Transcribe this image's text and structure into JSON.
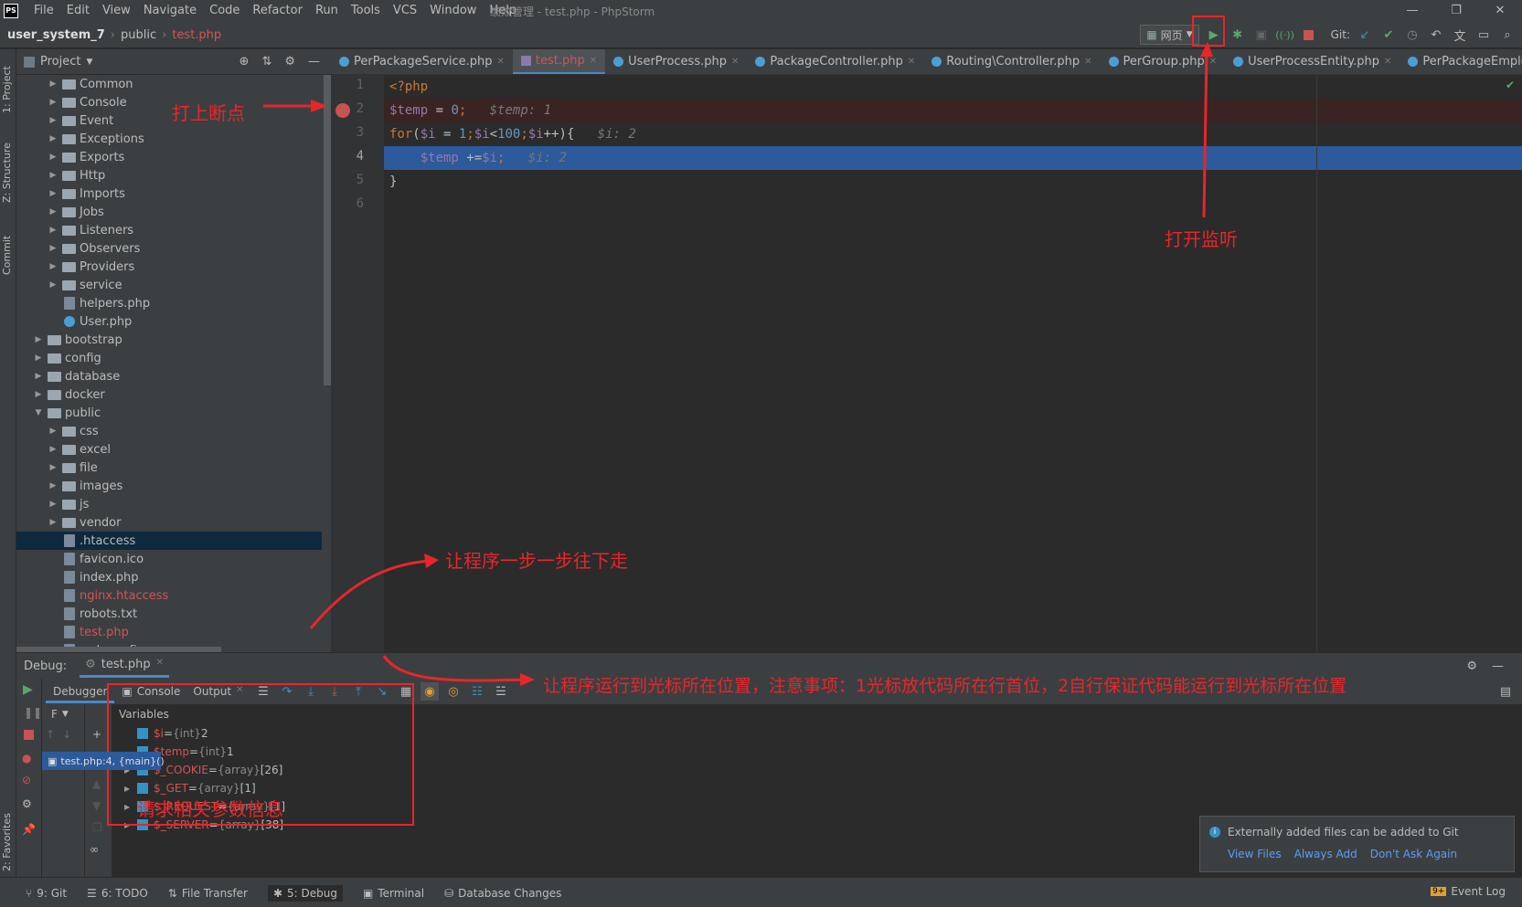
{
  "app": {
    "logo": "PS",
    "title": "绩效管理 - test.php - PhpStorm"
  },
  "menu": [
    "File",
    "Edit",
    "View",
    "Navigate",
    "Code",
    "Refactor",
    "Run",
    "Tools",
    "VCS",
    "Window",
    "Help"
  ],
  "breadcrumb": {
    "project": "user_system_7",
    "folder": "public",
    "file": "test.php"
  },
  "toolbar": {
    "run_config": "网页",
    "git_label": "Git:"
  },
  "project_panel": {
    "title": "Project",
    "items": [
      {
        "label": "Common",
        "type": "folder"
      },
      {
        "label": "Console",
        "type": "folder"
      },
      {
        "label": "Event",
        "type": "folder"
      },
      {
        "label": "Exceptions",
        "type": "folder"
      },
      {
        "label": "Exports",
        "type": "folder"
      },
      {
        "label": "Http",
        "type": "folder"
      },
      {
        "label": "Imports",
        "type": "folder"
      },
      {
        "label": "Jobs",
        "type": "folder"
      },
      {
        "label": "Listeners",
        "type": "folder"
      },
      {
        "label": "Observers",
        "type": "folder"
      },
      {
        "label": "Providers",
        "type": "folder"
      },
      {
        "label": "service",
        "type": "folder"
      },
      {
        "label": "helpers.php",
        "type": "file"
      },
      {
        "label": "User.php",
        "type": "class"
      },
      {
        "label": "bootstrap",
        "type": "folder"
      },
      {
        "label": "config",
        "type": "folder"
      },
      {
        "label": "database",
        "type": "folder"
      },
      {
        "label": "docker",
        "type": "folder"
      },
      {
        "label": "public",
        "type": "folder-open"
      },
      {
        "label": "css",
        "type": "folder"
      },
      {
        "label": "excel",
        "type": "folder"
      },
      {
        "label": "file",
        "type": "folder"
      },
      {
        "label": "images",
        "type": "folder"
      },
      {
        "label": "js",
        "type": "folder"
      },
      {
        "label": "vendor",
        "type": "folder"
      },
      {
        "label": ".htaccess",
        "type": "file"
      },
      {
        "label": "favicon.ico",
        "type": "file"
      },
      {
        "label": "index.php",
        "type": "file"
      },
      {
        "label": "nginx.htaccess",
        "type": "file-red"
      },
      {
        "label": "robots.txt",
        "type": "file"
      },
      {
        "label": "test.php",
        "type": "file-red"
      },
      {
        "label": "web.config",
        "type": "file"
      }
    ]
  },
  "tabs": [
    "PerPackageService.php",
    "test.php",
    "UserProcess.php",
    "PackageController.php",
    "Routing\\Controller.php",
    "PerGroup.php",
    "UserProcessEntity.php",
    "PerPackageEmployee."
  ],
  "code": {
    "lines": [
      "1",
      "2",
      "3",
      "4",
      "5",
      "6"
    ],
    "l1": "<?php",
    "l2_var": "$temp",
    "l2_rest": " = ",
    "l2_num": "0",
    "l2_semi": ";",
    "l2_inline": "$temp: 1",
    "l3_kw": "for",
    "l3_a": "(",
    "l3_v1": "$i",
    "l3_b": " = ",
    "l3_n1": "1",
    "l3_c": ";",
    "l3_v2": "$i",
    "l3_d": "<",
    "l3_n2": "100",
    "l3_e": ";",
    "l3_v3": "$i",
    "l3_f": "++){",
    "l3_inline": "$i: 2",
    "l4_v1": "$temp",
    "l4_a": " +=",
    "l4_v2": "$i",
    "l4_b": ";",
    "l4_inline": "$i: 2",
    "l5": "}"
  },
  "debug": {
    "label": "Debug:",
    "session": "test.php",
    "tab_debugger": "Debugger",
    "tab_console": "Console",
    "tab_output": "Output",
    "frames_label": "F",
    "variables_label": "Variables",
    "frame": "test.php:4, {main}()",
    "vars": [
      {
        "name": "$i",
        "type": "{int}",
        "value": "2"
      },
      {
        "name": "$temp",
        "type": "{int}",
        "value": "1"
      },
      {
        "name": "$_COOKIE",
        "type": "{array}",
        "value": "[26]"
      },
      {
        "name": "$_GET",
        "type": "{array}",
        "value": "[1]"
      },
      {
        "name": "$_REQUEST",
        "type": "{array}",
        "value": "[1]"
      },
      {
        "name": "$_SERVER",
        "type": "{array}",
        "value": "[38]"
      }
    ]
  },
  "notification": {
    "text": "Externally added files can be added to Git",
    "view": "View Files",
    "always": "Always Add",
    "dont": "Don't Ask Again"
  },
  "statusbar": [
    "9: Git",
    "6: TODO",
    "File Transfer",
    "5: Debug",
    "Terminal",
    "Database Changes"
  ],
  "event_log": "Event Log",
  "event_badge": "9+",
  "side_tabs": {
    "project": "1: Project",
    "structure": "Z: Structure",
    "commit": "Commit",
    "favorites": "2: Favorites"
  },
  "annotations": {
    "breakpoint": "打上断点",
    "listen": "打开监听",
    "step": "让程序一步一步往下走",
    "cursor": "让程序运行到光标所在位置，注意事项：1光标放代码所在行首位，2自行保证代码能运行到光标所在位置",
    "params": "请求相关参数信息"
  },
  "colors": {
    "accent": "#4a88c7",
    "annotation": "#e8262a",
    "selected_line": "#2d5a9a"
  }
}
